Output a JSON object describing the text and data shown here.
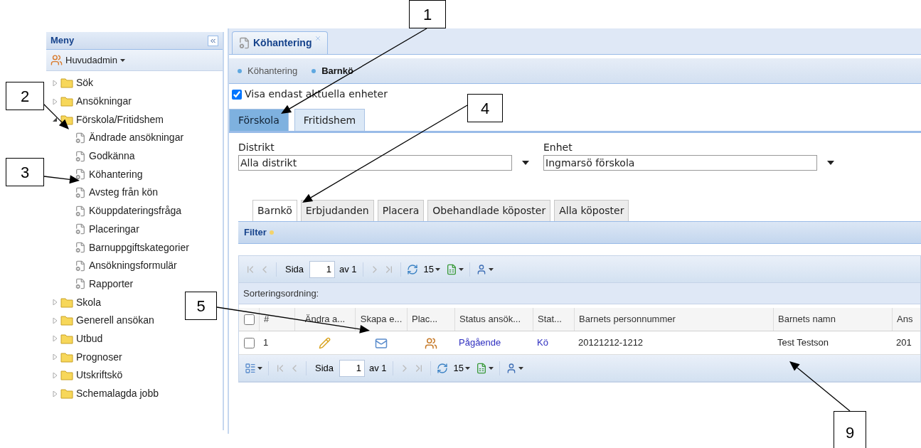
{
  "menu": {
    "title": "Meny",
    "user": "Huvudadmin",
    "tree": [
      {
        "label": "Sök",
        "kind": "folder",
        "expanded": false
      },
      {
        "label": "Ansökningar",
        "kind": "folder",
        "expanded": false
      },
      {
        "label": "Förskola/Fritidshem",
        "kind": "folder",
        "expanded": true,
        "children": [
          {
            "label": "Ändrade ansökningar",
            "kind": "page"
          },
          {
            "label": "Godkänna",
            "kind": "page"
          },
          {
            "label": "Köhantering",
            "kind": "page"
          },
          {
            "label": "Avsteg från kön",
            "kind": "page"
          },
          {
            "label": "Köuppdateringsfråga",
            "kind": "page"
          },
          {
            "label": "Placeringar",
            "kind": "page"
          },
          {
            "label": "Barnuppgiftskategorier",
            "kind": "page"
          },
          {
            "label": "Ansökningsformulär",
            "kind": "page"
          },
          {
            "label": "Rapporter",
            "kind": "page"
          }
        ]
      },
      {
        "label": "Skola",
        "kind": "folder",
        "expanded": false
      },
      {
        "label": "Generell ansökan",
        "kind": "folder",
        "expanded": false
      },
      {
        "label": "Utbud",
        "kind": "folder",
        "expanded": false
      },
      {
        "label": "Prognoser",
        "kind": "folder",
        "expanded": false
      },
      {
        "label": "Utskriftskö",
        "kind": "folder",
        "expanded": false
      },
      {
        "label": "Schemalagda jobb",
        "kind": "folder",
        "expanded": false
      }
    ]
  },
  "tab": {
    "title": "Köhantering"
  },
  "breadcrumb": [
    "Köhantering",
    "Barnkö"
  ],
  "only_current_units": {
    "label": "Visa endast aktuella enheter",
    "checked": true
  },
  "school_tabs": [
    {
      "label": "Förskola",
      "selected": true
    },
    {
      "label": "Fritidshem",
      "selected": false
    }
  ],
  "fields": [
    {
      "label": "Distrikt",
      "value": "Alla distrikt"
    },
    {
      "label": "Enhet",
      "value": "Ingmarsö förskola"
    }
  ],
  "queue_tabs": [
    {
      "label": "Barnkö",
      "selected": true
    },
    {
      "label": "Erbjudanden",
      "selected": false
    },
    {
      "label": "Placera",
      "selected": false
    },
    {
      "label": "Obehandlade köposter",
      "selected": false
    },
    {
      "label": "Alla köposter",
      "selected": false
    }
  ],
  "filter": {
    "title": "Filter"
  },
  "pager_top": {
    "page_label": "Sida",
    "page": "1",
    "of": "av 1",
    "page_size": "15"
  },
  "sort_label": "Sorteringsordning:",
  "table": {
    "select_all": false,
    "columns": [
      "#",
      "Ändra a...",
      "Skapa e...",
      "Plac...",
      "Status ansök...",
      "Stat...",
      "Barnets personnummer",
      "Barnets namn",
      "Ans"
    ],
    "rows": [
      {
        "checked": false,
        "cells": [
          {
            "kind": "text",
            "text": "1"
          },
          {
            "kind": "edit"
          },
          {
            "kind": "email"
          },
          {
            "kind": "placement"
          },
          {
            "kind": "link",
            "text": "Pågående"
          },
          {
            "kind": "link",
            "text": "Kö"
          },
          {
            "kind": "text",
            "text": "20121212-1212"
          },
          {
            "kind": "text",
            "text": "Test Testson"
          },
          {
            "kind": "text",
            "text": "201"
          }
        ]
      }
    ]
  },
  "pager_bottom": {
    "page_label": "Sida",
    "page": "1",
    "of": "av 1",
    "page_size": "15"
  },
  "callouts": [
    {
      "label": "1"
    },
    {
      "label": "2"
    },
    {
      "label": "3"
    },
    {
      "label": "4"
    },
    {
      "label": "5"
    },
    {
      "label": "9"
    }
  ]
}
